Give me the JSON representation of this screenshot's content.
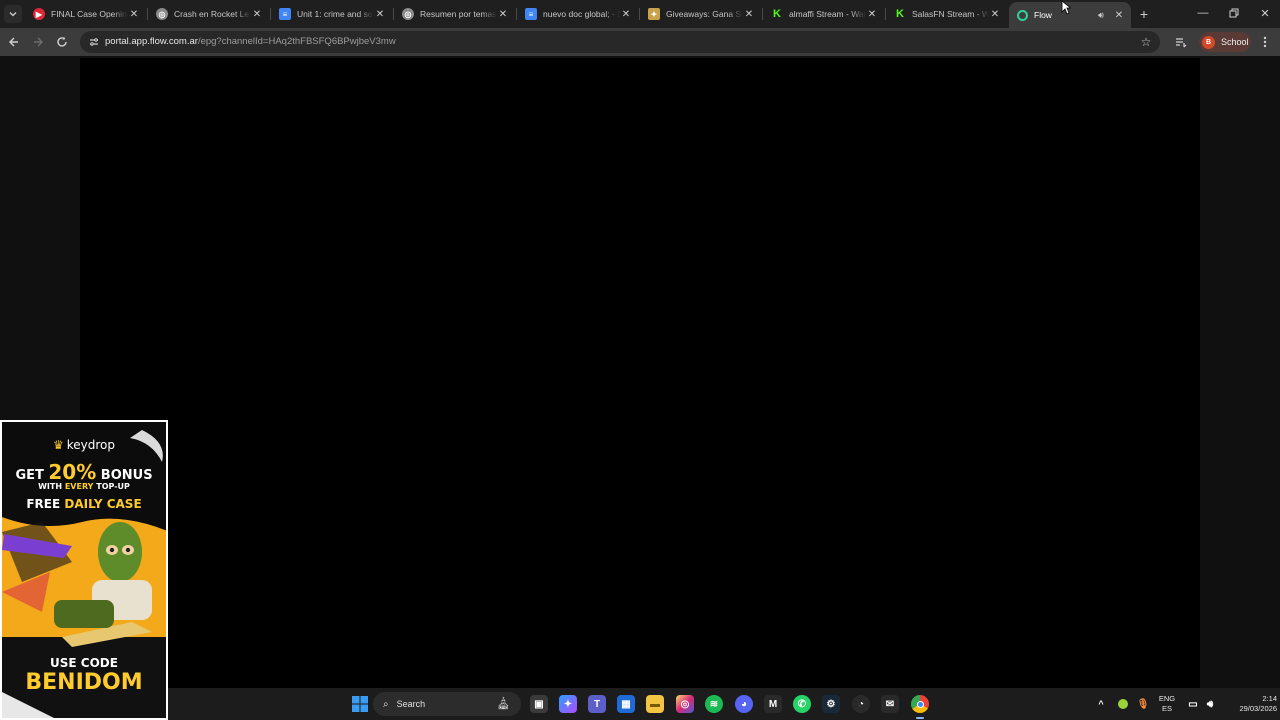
{
  "browser": {
    "tabs": [
      {
        "title": "FINAL Case Opening",
        "favicon_color": "#e12638",
        "favicon_glyph": "▶"
      },
      {
        "title": "Crash en Rocket Leag",
        "favicon_color": "#8a8a8a",
        "favicon_glyph": "◎"
      },
      {
        "title": "Unit 1: crime and soc",
        "favicon_color": "#4285f4",
        "favicon_glyph": "≡"
      },
      {
        "title": "Resumen por temas",
        "favicon_color": "#8a8a8a",
        "favicon_glyph": "◎"
      },
      {
        "title": "nuevo doc global; - D",
        "favicon_color": "#4285f4",
        "favicon_glyph": "≡"
      },
      {
        "title": "Giveaways: Gana Skin",
        "favicon_color": "#c7a24a",
        "favicon_glyph": "✦"
      },
      {
        "title": "almaffi Stream - Wat",
        "favicon_color": "#53fc18",
        "favicon_glyph": "K"
      },
      {
        "title": "SalasFN Stream - Wa",
        "favicon_color": "#53fc18",
        "favicon_glyph": "K"
      },
      {
        "title": "Flow",
        "favicon_color": "#2fcf9b",
        "favicon_glyph": "○",
        "active": true
      }
    ],
    "url_host": "portal.app.flow.com.ar",
    "url_path": "/epg?channelId=HAq2thFBSFQ6BPwjbeV3mw",
    "profile_label": "School",
    "profile_initial": "B"
  },
  "ad": {
    "brand": "keydrop",
    "line1_prefix": "GET ",
    "line1_percent": "20%",
    "line1_suffix": " BONUS",
    "line2_prefix": "WITH ",
    "line2_highlight": "EVERY",
    "line2_suffix": " TOP-UP",
    "line3_prefix": "FREE ",
    "line3_highlight": "DAILY CASE",
    "code_label": "USE CODE",
    "code_value": "BENIDOM"
  },
  "taskbar": {
    "search_label": "Search",
    "lang_top": "ENG",
    "lang_bottom": "ES",
    "time": "2:14",
    "date": "29/03/2026"
  }
}
